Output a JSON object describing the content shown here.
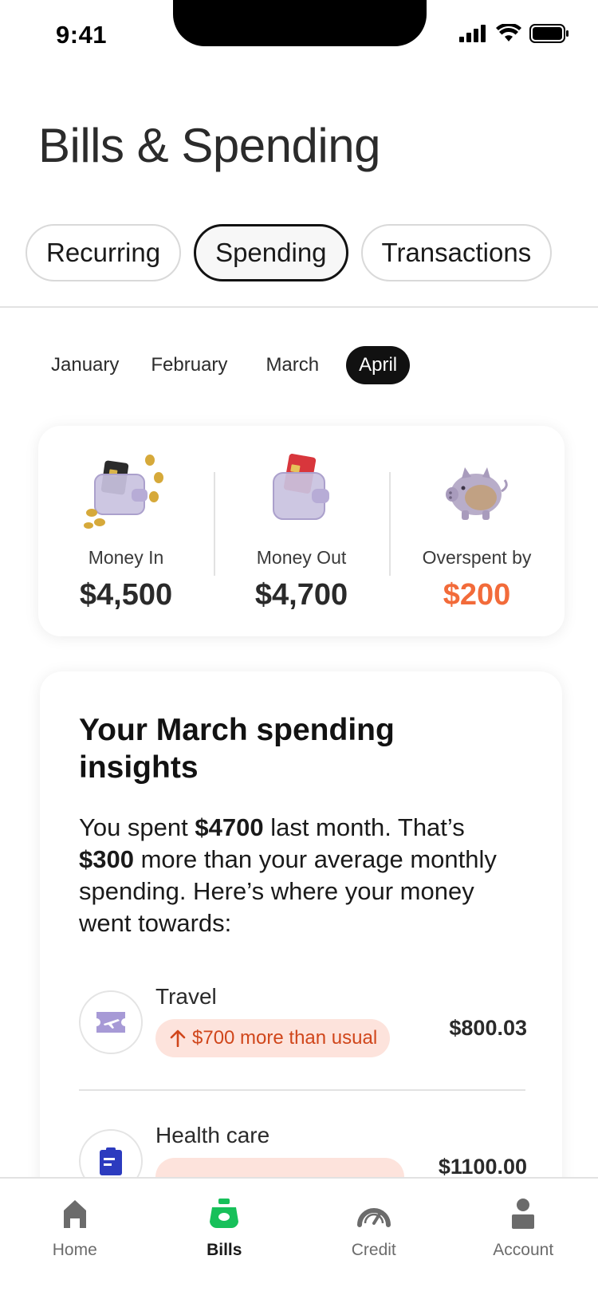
{
  "status_bar": {
    "time": "9:41"
  },
  "page": {
    "title": "Bills & Spending"
  },
  "tabs": [
    {
      "label": "Recurring",
      "active": false
    },
    {
      "label": "Spending",
      "active": true
    },
    {
      "label": "Transactions",
      "active": false
    }
  ],
  "months": [
    {
      "label": "January",
      "active": false
    },
    {
      "label": "February",
      "active": false
    },
    {
      "label": "March",
      "active": false
    },
    {
      "label": "April",
      "active": true
    }
  ],
  "summary": {
    "money_in": {
      "label": "Money In",
      "value": "$4,500",
      "icon": "wallet-coins-icon"
    },
    "money_out": {
      "label": "Money Out",
      "value": "$4,700",
      "icon": "wallet-card-icon"
    },
    "overspent": {
      "label": "Overspent by",
      "value": "$200",
      "icon": "piggy-bank-icon"
    }
  },
  "insights": {
    "title": "Your March spending insights",
    "text_1": "You spent ",
    "amount_1": "$4700",
    "text_2": " last month. That’s ",
    "amount_2": "$300",
    "text_3": " more than your average monthly spending. Here’s where your money went towards:",
    "categories": [
      {
        "name": "Travel",
        "badge": "$700 more than usual",
        "amount": "$800.03",
        "icon": "ticket-plane-icon"
      },
      {
        "name": "Health care",
        "badge": "",
        "amount": "$1100.00",
        "icon": "medical-clipboard-icon"
      }
    ]
  },
  "nav": [
    {
      "label": "Home",
      "icon": "home-icon",
      "active": false
    },
    {
      "label": "Bills",
      "icon": "bills-icon",
      "active": true
    },
    {
      "label": "Credit",
      "icon": "gauge-icon",
      "active": false
    },
    {
      "label": "Account",
      "icon": "person-icon",
      "active": false
    }
  ],
  "colors": {
    "accent_green": "#17c05a",
    "overspent_orange": "#f26b3a",
    "badge_bg": "#fde3dc",
    "badge_text": "#d0461b"
  }
}
